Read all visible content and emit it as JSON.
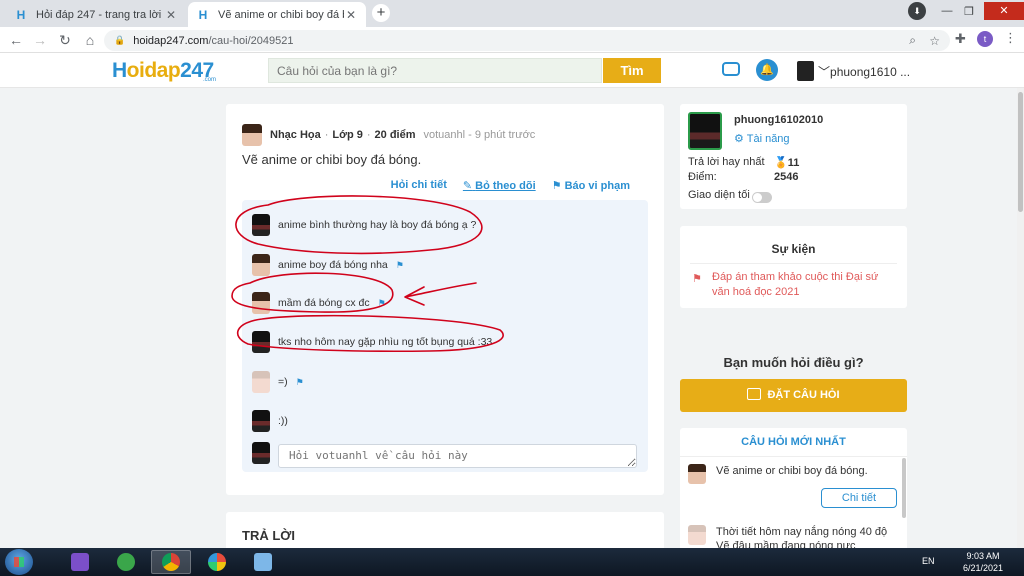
{
  "browser": {
    "tabs": [
      {
        "title": "Hỏi đáp 247 - trang tra lời",
        "active": false
      },
      {
        "title": "Vẽ anime or chibi boy đá bóng. d",
        "active": true
      }
    ],
    "url_host": "hoidap247.com",
    "url_path": "/cau-hoi/2049521",
    "profile_initial": "t"
  },
  "site": {
    "logo_main": "oidap",
    "logo_h": "H",
    "logo_num": "247",
    "logo_sub": ".com",
    "search_placeholder": "Câu hỏi của bạn là gì?",
    "search_button": "Tìm",
    "username": "phuong1610 ..."
  },
  "question": {
    "subject": "Nhạc Họa",
    "grade": "Lớp 9",
    "points": "20 điểm",
    "author_time": "votuanhl - 9 phút trước",
    "text": "Vẽ anime or chibi boy đá bóng.",
    "actions": [
      "Hỏi chi tiết",
      "Bỏ theo dõi",
      "Báo vi phạm"
    ],
    "comments": [
      {
        "text": "anime bình thường hay là boy đá bóng ạ ?",
        "flag": false
      },
      {
        "text": "anime boy đá bóng nha",
        "flag": true
      },
      {
        "text": "mầm đá bóng cx đc",
        "flag": true
      },
      {
        "text": "tks nho hôm nay gặp nhìu ng tốt bụng quá :33",
        "flag": false
      },
      {
        "text": "=)",
        "flag": true
      },
      {
        "text": ":))",
        "flag": false
      }
    ],
    "reply_placeholder": "Hỏi votuanhl về câu hỏi này"
  },
  "answer": {
    "title": "TRẢ LỜI"
  },
  "profile": {
    "name": "phuong16102010",
    "rank": "Tài năng",
    "best_label": "Trả lời hay nhất",
    "best_value": "11",
    "points_label": "Điểm:",
    "points_value": "2546",
    "dark_label": "Giao diện tối"
  },
  "event": {
    "title": "Sự kiện",
    "text": "Đáp án tham khảo cuộc thi Đại sứ văn hoá đọc 2021"
  },
  "ask": {
    "title": "Bạn muốn hỏi điều gì?",
    "button": "ĐẶT CÂU HỎI"
  },
  "newest": {
    "title": "CÂU HỎI MỚI NHẤT",
    "items": [
      "Vẽ anime or chibi boy đá bóng.",
      "Thời tiết hôm nay nắng nóng 40 độ Vẽ đâu mầm đang nóng nực"
    ],
    "detail_button": "Chi tiết"
  },
  "taskbar": {
    "lang": "EN",
    "time": "9:03 AM",
    "date": "6/21/2021"
  },
  "colors": {
    "brand_blue": "#2a8fd1",
    "brand_yellow": "#e7ad17",
    "annotation_red": "#d0021b"
  }
}
